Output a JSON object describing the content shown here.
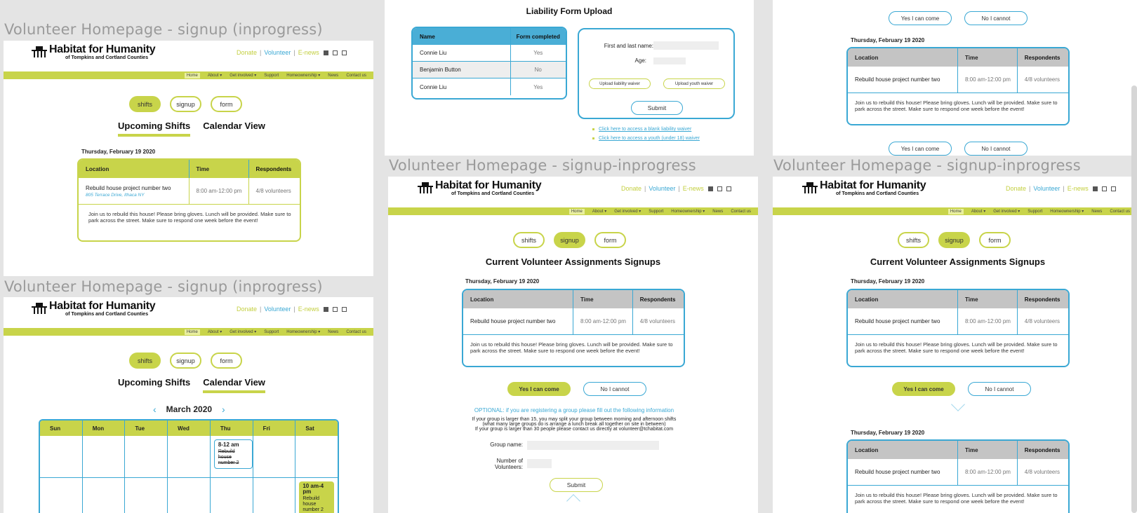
{
  "frames": {
    "f1": "Volunteer Homepage - signup (inprogress)",
    "f2": "Volunteer Homepage - signup (inprogress)",
    "f3": "Volunteer Homepage - signup-inprogress",
    "f4": "Volunteer Homepage - signup-inprogress"
  },
  "brand": {
    "name": "Habitat for Humanity",
    "sub": "of Tompkins and Cortland Counties",
    "green": "#c8d44a",
    "blue": "#3aa8d4"
  },
  "toplinks": {
    "donate": "Donate",
    "sep": "|",
    "volunteer": "Volunteer",
    "enews": "E-news"
  },
  "nav": [
    "Home",
    "About ▾",
    "Get involved ▾",
    "Support",
    "Homeownership ▾",
    "News",
    "Contact us"
  ],
  "pills": {
    "shifts": "shifts",
    "signup": "signup",
    "form": "form"
  },
  "tabs": {
    "upcoming": "Upcoming Shifts",
    "calendar": "Calendar View"
  },
  "shift": {
    "date": "Thursday, February 19 2020",
    "h_location": "Location",
    "h_time": "Time",
    "h_resp": "Respondents",
    "name": "Rebuild house project number two",
    "address": "805 Terrace Drive, Ithaca NY",
    "time": "8:00 am-12:00 pm",
    "resp": "4/8 volunteers",
    "desc": "Join us to rebuild this house! Please bring gloves. Lunch will be provided. Make sure to park across the street. Make sure to respond one week before the event!"
  },
  "calendar": {
    "month": "March 2020",
    "days": [
      "Sun",
      "Mon",
      "Tue",
      "Wed",
      "Thu",
      "Fri",
      "Sat"
    ],
    "ev1_time": "8-12 am",
    "ev1_name": "Rebuild house number 2",
    "ev2_time": "10 am-4 pm",
    "ev2_name": "Rebuild house number 2"
  },
  "liability": {
    "title": "Liability Form Upload",
    "h_name": "Name",
    "h_form": "Form completed",
    "rows": [
      {
        "name": "Connie Liu",
        "done": "Yes"
      },
      {
        "name": "Benjamin Button",
        "done": "No"
      },
      {
        "name": "Connie Liu",
        "done": "Yes"
      }
    ],
    "first_last": "First and last name:",
    "age": "Age:",
    "upload_liab": "Upload liability waiver",
    "upload_youth": "Upload youth waiver",
    "submit": "Submit",
    "link1": "Click here to access a blank liability waiver",
    "link2": "Click here to access a youth (under 18) waiver"
  },
  "signup": {
    "title": "Current Volunteer Assignments Signups",
    "yes": "Yes I can come",
    "no": "No I cannot",
    "opt_title": "OPTIONAL: if you are registering a group please fill out the following information",
    "opt_l1": "If your group is larger than 15, you may split your group between morning and afternoon shifts",
    "opt_l2": "(what many large groups do is arrange a lunch break all together on site in between)",
    "opt_l3": "If your group is larger than 30 people please contact us directly at volunteer@tchabitat.com",
    "group_name": "Group name:",
    "num_vol": "Number of Volunteers:",
    "submit": "Submit"
  }
}
